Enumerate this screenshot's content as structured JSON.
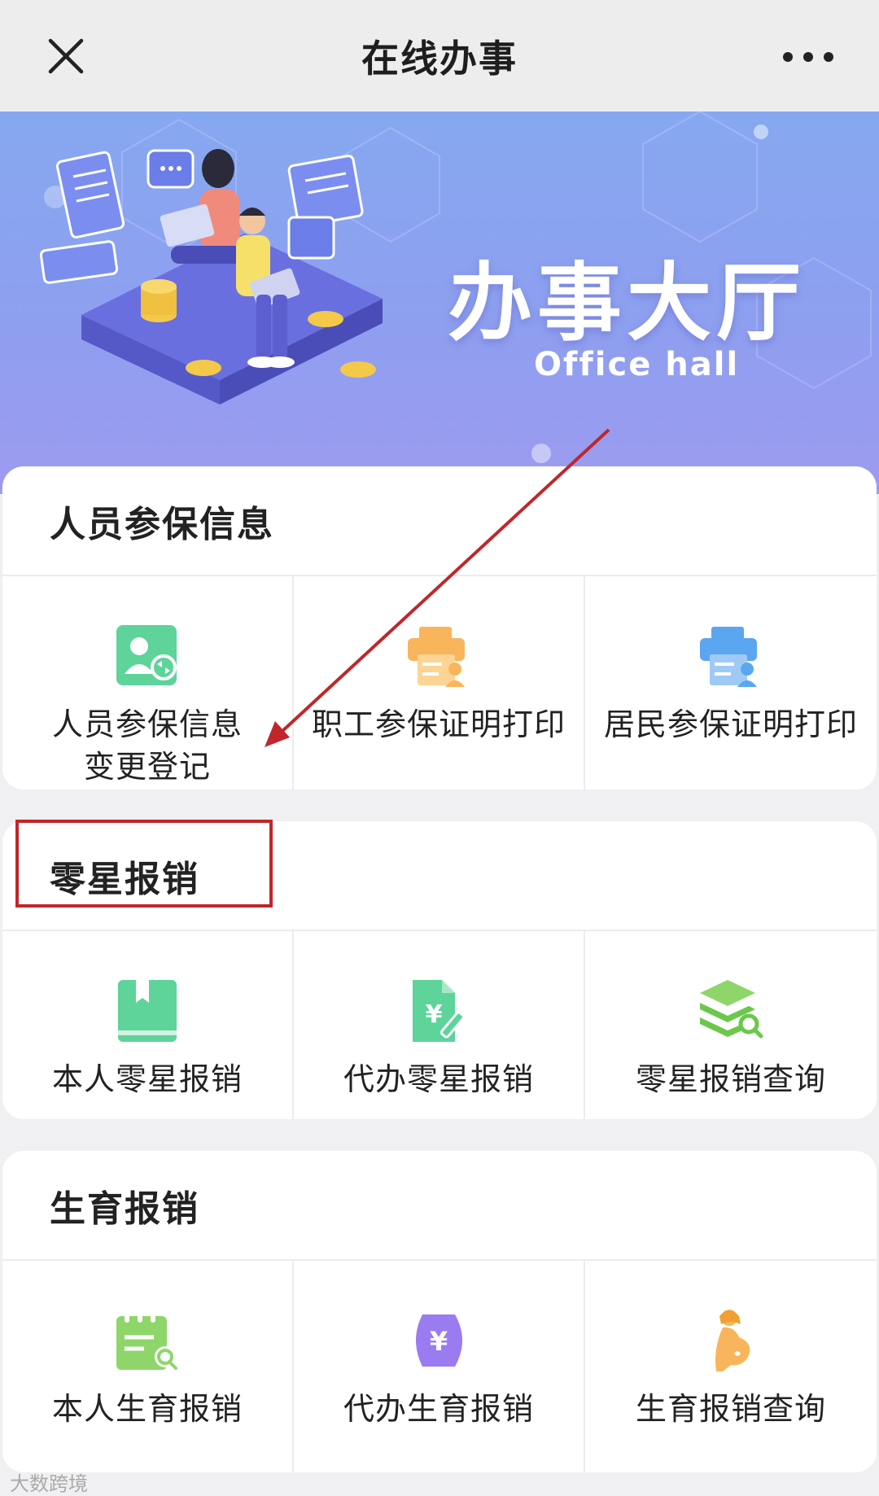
{
  "header": {
    "title": "在线办事",
    "close_icon": "close-icon",
    "more_icon": "more-icon"
  },
  "banner": {
    "title": "办事大厅",
    "subtitle": "Office hall"
  },
  "sections": [
    {
      "title": "人员参保信息",
      "items": [
        {
          "label": "人员参保信息变更登记",
          "icon": "person-change-icon",
          "color": "#5ed39a"
        },
        {
          "label": "职工参保证明打印",
          "icon": "printer-person-icon",
          "color": "#f8b55b"
        },
        {
          "label": "居民参保证明打印",
          "icon": "printer-person-icon",
          "color": "#5aa6f0"
        }
      ]
    },
    {
      "title": "零星报销",
      "items": [
        {
          "label": "本人零星报销",
          "icon": "book-icon",
          "color": "#5ed39a"
        },
        {
          "label": "代办零星报销",
          "icon": "yuan-document-icon",
          "color": "#5ed39a"
        },
        {
          "label": "零星报销查询",
          "icon": "layers-search-icon",
          "color": "#8ed66a"
        }
      ]
    },
    {
      "title": "生育报销",
      "items": [
        {
          "label": "本人生育报销",
          "icon": "calendar-search-icon",
          "color": "#8ed66a"
        },
        {
          "label": "代办生育报销",
          "icon": "yuan-belly-icon",
          "color": "#9a7bf0"
        },
        {
          "label": "生育报销查询",
          "icon": "pregnant-woman-icon",
          "color": "#f8b55b"
        }
      ]
    }
  ],
  "annotation_color": "#c0262a",
  "watermark": "大数跨境"
}
